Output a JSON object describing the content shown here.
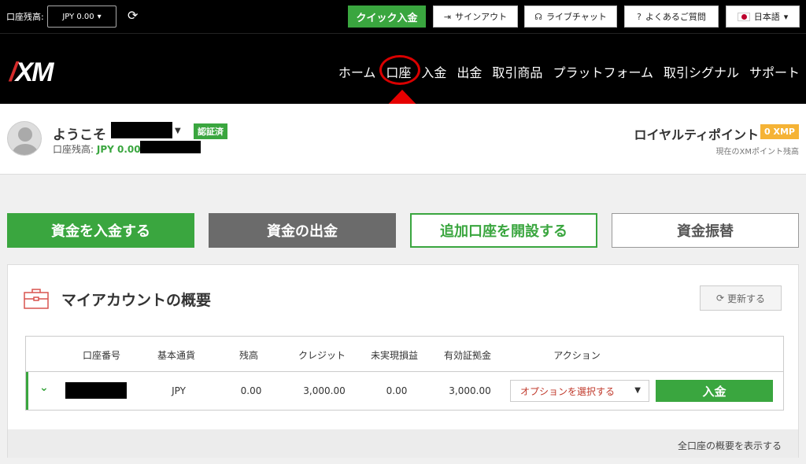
{
  "topbar": {
    "balance_label": "口座残高:",
    "balance_value": "JPY 0.00",
    "quick_deposit": "クイック入金",
    "sign_out": "サインアウト",
    "live_chat": "ライブチャット",
    "faq": "よくあるご質問",
    "language": "日本語"
  },
  "brand": {
    "logo_text": "XM"
  },
  "nav": {
    "items": [
      "ホーム",
      "口座",
      "入金",
      "出金",
      "取引商品",
      "プラットフォーム",
      "取引シグナル",
      "サポート"
    ]
  },
  "welcome": {
    "greeting": "ようこそ",
    "verified_badge": "認証済",
    "balance_label": "口座残高:",
    "balance_value": "JPY 0.00",
    "loyalty_title": "ロイヤルティポイント",
    "loyalty_badge": "0 XMP",
    "loyalty_sub": "現在のXMポイント残高"
  },
  "actions": {
    "deposit": "資金を入金する",
    "withdraw": "資金の出金",
    "open_account": "追加口座を開設する",
    "transfer": "資金振替"
  },
  "overview": {
    "title": "マイアカウントの概要",
    "refresh": "更新する",
    "headers": [
      "口座番号",
      "基本通貨",
      "残高",
      "クレジット",
      "未実現損益",
      "有効証拠金",
      "アクション"
    ],
    "row": {
      "currency": "JPY",
      "balance": "0.00",
      "credit": "3,000.00",
      "unrealized": "0.00",
      "equity": "3,000.00",
      "option_select": "オプションを選択する",
      "deposit": "入金"
    },
    "show_all": "全口座の概要を表示する"
  },
  "colors": {
    "green": "#3aa63f",
    "dark_gray": "#6b6b6b",
    "red_annotation": "#d90000",
    "gold": "#f5b335"
  }
}
